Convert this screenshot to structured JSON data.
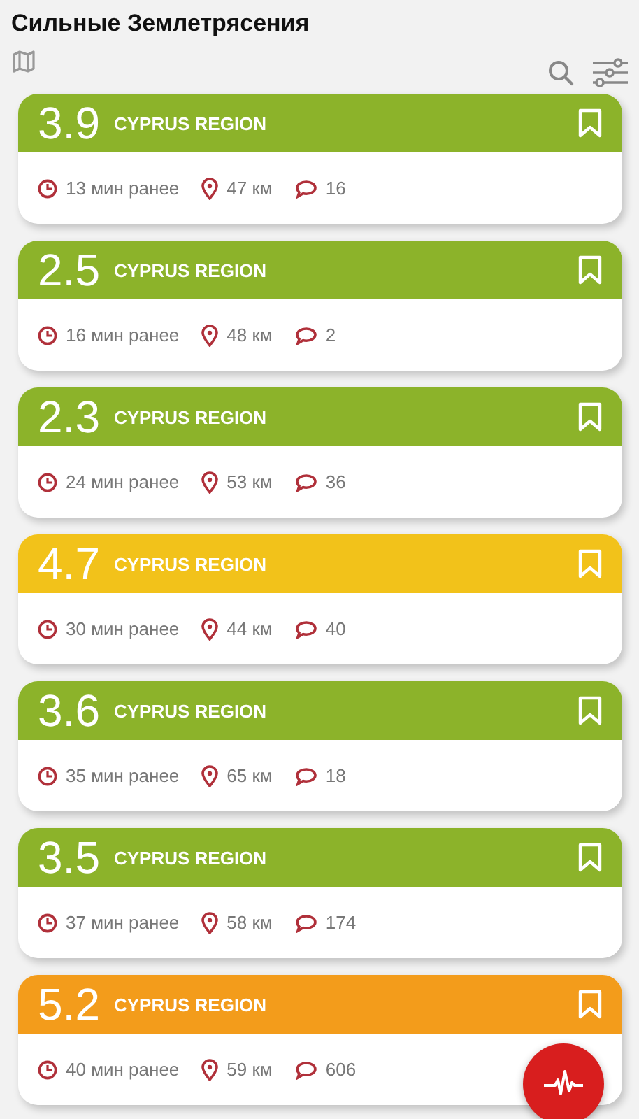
{
  "title": "Сильные Землетрясения",
  "quakes": [
    {
      "magnitude": "3.9",
      "region": "CYPRUS REGION",
      "color": "#8cb32a",
      "time": "13 мин ранее",
      "distance": "47 км",
      "comments": "16"
    },
    {
      "magnitude": "2.5",
      "region": "CYPRUS REGION",
      "color": "#8cb32a",
      "time": "16 мин ранее",
      "distance": "48 км",
      "comments": "2"
    },
    {
      "magnitude": "2.3",
      "region": "CYPRUS REGION",
      "color": "#8cb32a",
      "time": "24 мин ранее",
      "distance": "53 км",
      "comments": "36"
    },
    {
      "magnitude": "4.7",
      "region": "CYPRUS REGION",
      "color": "#f2c21a",
      "time": "30 мин ранее",
      "distance": "44 км",
      "comments": "40"
    },
    {
      "magnitude": "3.6",
      "region": "CYPRUS REGION",
      "color": "#8cb32a",
      "time": "35 мин ранее",
      "distance": "65 км",
      "comments": "18"
    },
    {
      "magnitude": "3.5",
      "region": "CYPRUS REGION",
      "color": "#8cb32a",
      "time": "37 мин ранее",
      "distance": "58 км",
      "comments": "174"
    },
    {
      "magnitude": "5.2",
      "region": "CYPRUS REGION",
      "color": "#f39c1b",
      "time": "40 мин ранее",
      "distance": "59 км",
      "comments": "606"
    }
  ]
}
